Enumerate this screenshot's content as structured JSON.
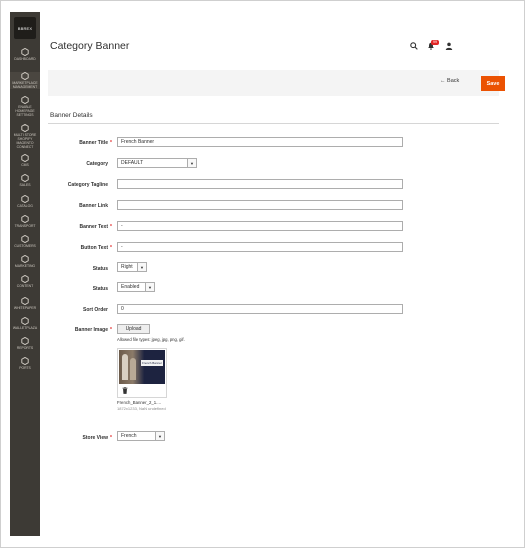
{
  "sidebar": {
    "logo_text": "BBREX",
    "items": [
      {
        "label": "DASHBOARD",
        "icon": "dashboard-icon"
      },
      {
        "label": "MARKETPLACE MANAGEMENT",
        "icon": "marketplace-icon"
      },
      {
        "label": "ENABLE HOMEPAGE SETTINGS",
        "icon": "homepage-icon"
      },
      {
        "label": "MULTI STORE SHOPIFY MAGENTO CONNECT",
        "icon": "connect-icon"
      },
      {
        "label": "CMS",
        "icon": "cms-icon"
      },
      {
        "label": "SALES",
        "icon": "dollar-icon"
      },
      {
        "label": "CATALOG",
        "icon": "catalog-icon"
      },
      {
        "label": "TRANSPORT",
        "icon": "hexagon-icon"
      },
      {
        "label": "CUSTOMERS",
        "icon": "person-icon"
      },
      {
        "label": "MARKETING",
        "icon": "megaphone-icon"
      },
      {
        "label": "CONTENT",
        "icon": "content-icon"
      },
      {
        "label": "WHITEPAPER",
        "icon": "hexagon-icon"
      },
      {
        "label": "WALLETPLAZA",
        "icon": "store-icon"
      },
      {
        "label": "REPORTS",
        "icon": "bar-chart-icon"
      },
      {
        "label": "PORTS",
        "icon": "hexagon-icon"
      }
    ]
  },
  "header": {
    "title": "Category Banner",
    "notification_count": "99"
  },
  "actions": {
    "back_label": "Back",
    "save_label": "Save"
  },
  "section": {
    "title": "Banner Details"
  },
  "form": {
    "banner_title": {
      "label": "Banner Title",
      "value": "French Banner"
    },
    "category": {
      "label": "Category",
      "value": "DEFAULT"
    },
    "category_tagline": {
      "label": "Category Tagline",
      "value": ""
    },
    "banner_link": {
      "label": "Banner Link",
      "value": ""
    },
    "banner_text": {
      "label": "Banner Text",
      "value": "-"
    },
    "button_text": {
      "label": "Button Text",
      "value": "-"
    },
    "status_position": {
      "label": "Status",
      "value": "Right"
    },
    "status_enabled": {
      "label": "Status",
      "value": "Enabled"
    },
    "sort_order": {
      "label": "Sort Order",
      "value": "0"
    },
    "banner_image": {
      "label": "Banner Image",
      "upload_label": "Upload",
      "hint": "Allowed file types: jpeg, jpg, png, gif.",
      "thumb_text": "French Banner",
      "file_name": "French_Banner_2_1....",
      "file_meta": "1872x1233, NaN undefined"
    },
    "store_view": {
      "label": "Store View",
      "value": "French"
    }
  },
  "colors": {
    "sidebar_bg": "#3d3a35",
    "accent": "#eb5202",
    "required": "#e22626"
  }
}
